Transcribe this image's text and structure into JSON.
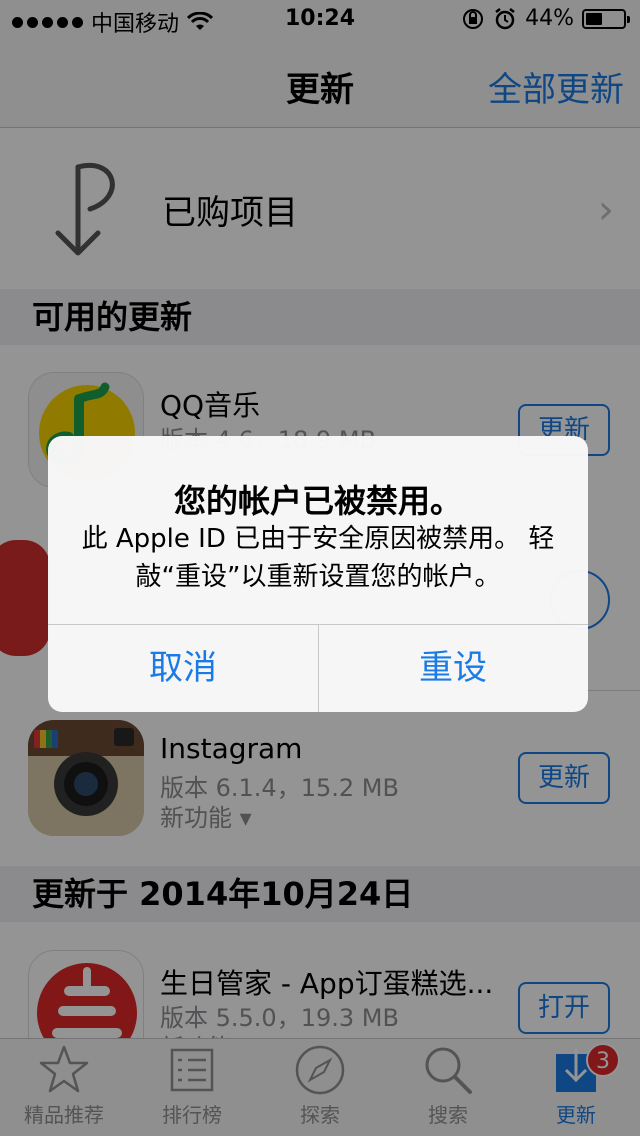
{
  "status": {
    "carrier": "中国移动",
    "time": "10:24",
    "battery": "44%",
    "battery_level": 0.44
  },
  "nav": {
    "title": "更新",
    "update_all": "全部更新"
  },
  "purchased": {
    "label": "已购项目"
  },
  "sections": {
    "available": "可用的更新",
    "updated_on": "更新于 2014年10月24日"
  },
  "apps": [
    {
      "name": "QQ音乐",
      "meta": "版本 4.6，18.9 MB",
      "button": "更新"
    },
    {
      "name": "Instagram",
      "meta": "版本 6.1.4，15.2 MB",
      "features": "新功能 ▾",
      "button": "更新"
    },
    {
      "name": "生日管家 - App订蛋糕选...",
      "meta": "版本 5.5.0，19.3 MB",
      "features": "新功能 ▾",
      "button": "打开"
    }
  ],
  "tabs": [
    {
      "label": "精品推荐",
      "icon": "star-icon"
    },
    {
      "label": "排行榜",
      "icon": "list-icon"
    },
    {
      "label": "探索",
      "icon": "compass-icon"
    },
    {
      "label": "搜索",
      "icon": "search-icon"
    },
    {
      "label": "更新",
      "icon": "download-icon",
      "badge": "3"
    }
  ],
  "alert": {
    "title": "您的帐户已被禁用。",
    "message": "此 Apple ID 已由于安全原因被禁用。 轻敲“重设”以重新设置您的帐户。",
    "cancel": "取消",
    "reset": "重设"
  },
  "colors": {
    "accent": "#1a7be6",
    "badge": "#e0282b"
  }
}
